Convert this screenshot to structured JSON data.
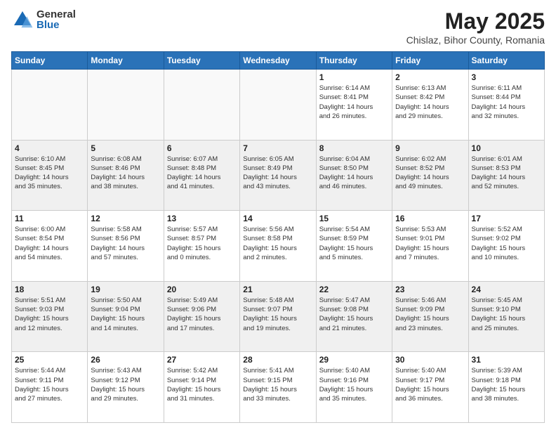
{
  "header": {
    "logo_general": "General",
    "logo_blue": "Blue",
    "title": "May 2025",
    "subtitle": "Chislaz, Bihor County, Romania"
  },
  "days_of_week": [
    "Sunday",
    "Monday",
    "Tuesday",
    "Wednesday",
    "Thursday",
    "Friday",
    "Saturday"
  ],
  "weeks": [
    [
      {
        "num": "",
        "info": ""
      },
      {
        "num": "",
        "info": ""
      },
      {
        "num": "",
        "info": ""
      },
      {
        "num": "",
        "info": ""
      },
      {
        "num": "1",
        "info": "Sunrise: 6:14 AM\nSunset: 8:41 PM\nDaylight: 14 hours\nand 26 minutes."
      },
      {
        "num": "2",
        "info": "Sunrise: 6:13 AM\nSunset: 8:42 PM\nDaylight: 14 hours\nand 29 minutes."
      },
      {
        "num": "3",
        "info": "Sunrise: 6:11 AM\nSunset: 8:44 PM\nDaylight: 14 hours\nand 32 minutes."
      }
    ],
    [
      {
        "num": "4",
        "info": "Sunrise: 6:10 AM\nSunset: 8:45 PM\nDaylight: 14 hours\nand 35 minutes."
      },
      {
        "num": "5",
        "info": "Sunrise: 6:08 AM\nSunset: 8:46 PM\nDaylight: 14 hours\nand 38 minutes."
      },
      {
        "num": "6",
        "info": "Sunrise: 6:07 AM\nSunset: 8:48 PM\nDaylight: 14 hours\nand 41 minutes."
      },
      {
        "num": "7",
        "info": "Sunrise: 6:05 AM\nSunset: 8:49 PM\nDaylight: 14 hours\nand 43 minutes."
      },
      {
        "num": "8",
        "info": "Sunrise: 6:04 AM\nSunset: 8:50 PM\nDaylight: 14 hours\nand 46 minutes."
      },
      {
        "num": "9",
        "info": "Sunrise: 6:02 AM\nSunset: 8:52 PM\nDaylight: 14 hours\nand 49 minutes."
      },
      {
        "num": "10",
        "info": "Sunrise: 6:01 AM\nSunset: 8:53 PM\nDaylight: 14 hours\nand 52 minutes."
      }
    ],
    [
      {
        "num": "11",
        "info": "Sunrise: 6:00 AM\nSunset: 8:54 PM\nDaylight: 14 hours\nand 54 minutes."
      },
      {
        "num": "12",
        "info": "Sunrise: 5:58 AM\nSunset: 8:56 PM\nDaylight: 14 hours\nand 57 minutes."
      },
      {
        "num": "13",
        "info": "Sunrise: 5:57 AM\nSunset: 8:57 PM\nDaylight: 15 hours\nand 0 minutes."
      },
      {
        "num": "14",
        "info": "Sunrise: 5:56 AM\nSunset: 8:58 PM\nDaylight: 15 hours\nand 2 minutes."
      },
      {
        "num": "15",
        "info": "Sunrise: 5:54 AM\nSunset: 8:59 PM\nDaylight: 15 hours\nand 5 minutes."
      },
      {
        "num": "16",
        "info": "Sunrise: 5:53 AM\nSunset: 9:01 PM\nDaylight: 15 hours\nand 7 minutes."
      },
      {
        "num": "17",
        "info": "Sunrise: 5:52 AM\nSunset: 9:02 PM\nDaylight: 15 hours\nand 10 minutes."
      }
    ],
    [
      {
        "num": "18",
        "info": "Sunrise: 5:51 AM\nSunset: 9:03 PM\nDaylight: 15 hours\nand 12 minutes."
      },
      {
        "num": "19",
        "info": "Sunrise: 5:50 AM\nSunset: 9:04 PM\nDaylight: 15 hours\nand 14 minutes."
      },
      {
        "num": "20",
        "info": "Sunrise: 5:49 AM\nSunset: 9:06 PM\nDaylight: 15 hours\nand 17 minutes."
      },
      {
        "num": "21",
        "info": "Sunrise: 5:48 AM\nSunset: 9:07 PM\nDaylight: 15 hours\nand 19 minutes."
      },
      {
        "num": "22",
        "info": "Sunrise: 5:47 AM\nSunset: 9:08 PM\nDaylight: 15 hours\nand 21 minutes."
      },
      {
        "num": "23",
        "info": "Sunrise: 5:46 AM\nSunset: 9:09 PM\nDaylight: 15 hours\nand 23 minutes."
      },
      {
        "num": "24",
        "info": "Sunrise: 5:45 AM\nSunset: 9:10 PM\nDaylight: 15 hours\nand 25 minutes."
      }
    ],
    [
      {
        "num": "25",
        "info": "Sunrise: 5:44 AM\nSunset: 9:11 PM\nDaylight: 15 hours\nand 27 minutes."
      },
      {
        "num": "26",
        "info": "Sunrise: 5:43 AM\nSunset: 9:12 PM\nDaylight: 15 hours\nand 29 minutes."
      },
      {
        "num": "27",
        "info": "Sunrise: 5:42 AM\nSunset: 9:14 PM\nDaylight: 15 hours\nand 31 minutes."
      },
      {
        "num": "28",
        "info": "Sunrise: 5:41 AM\nSunset: 9:15 PM\nDaylight: 15 hours\nand 33 minutes."
      },
      {
        "num": "29",
        "info": "Sunrise: 5:40 AM\nSunset: 9:16 PM\nDaylight: 15 hours\nand 35 minutes."
      },
      {
        "num": "30",
        "info": "Sunrise: 5:40 AM\nSunset: 9:17 PM\nDaylight: 15 hours\nand 36 minutes."
      },
      {
        "num": "31",
        "info": "Sunrise: 5:39 AM\nSunset: 9:18 PM\nDaylight: 15 hours\nand 38 minutes."
      }
    ]
  ]
}
